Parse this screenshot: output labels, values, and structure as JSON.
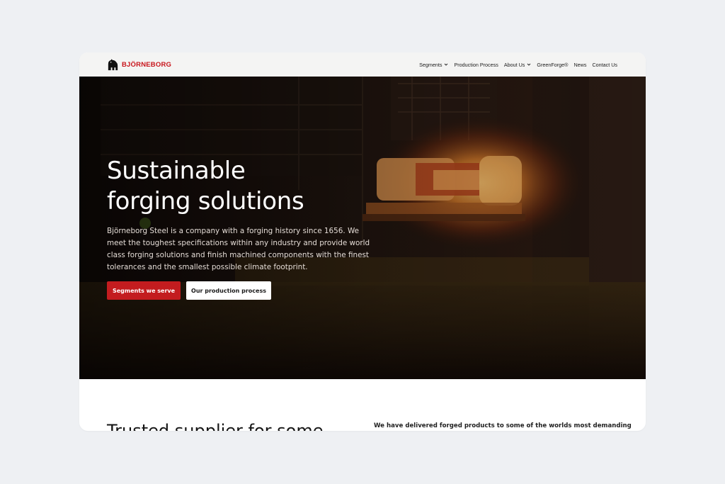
{
  "brand": {
    "name": "BJÖRNEBORG",
    "color": "#c8141b",
    "logo_icon": "bear-icon"
  },
  "nav": {
    "items": [
      {
        "label": "Segments",
        "has_dropdown": true
      },
      {
        "label": "Production Process",
        "has_dropdown": false
      },
      {
        "label": "About Us",
        "has_dropdown": true
      },
      {
        "label": "GreenForge®",
        "has_dropdown": false
      },
      {
        "label": "News",
        "has_dropdown": false
      },
      {
        "label": "Contact Us",
        "has_dropdown": false
      }
    ]
  },
  "hero": {
    "title_line1": "Sustainable",
    "title_line2": "forging solutions",
    "description": "Björneborg Steel is a company with a forging history since 1656. We meet the toughest specifications within any industry and provide world class forging solutions and finish machined components with the finest tolerances and the smallest possible climate footprint.",
    "primary_button": "Segments we serve",
    "secondary_button": "Our production process"
  },
  "section": {
    "heading": "Trusted supplier for some",
    "text": "We have delivered forged products to some of the worlds most demanding"
  },
  "colors": {
    "accent": "#c31c1f",
    "page_bg": "#eef0f3",
    "header_bg": "#f4f4f3"
  }
}
